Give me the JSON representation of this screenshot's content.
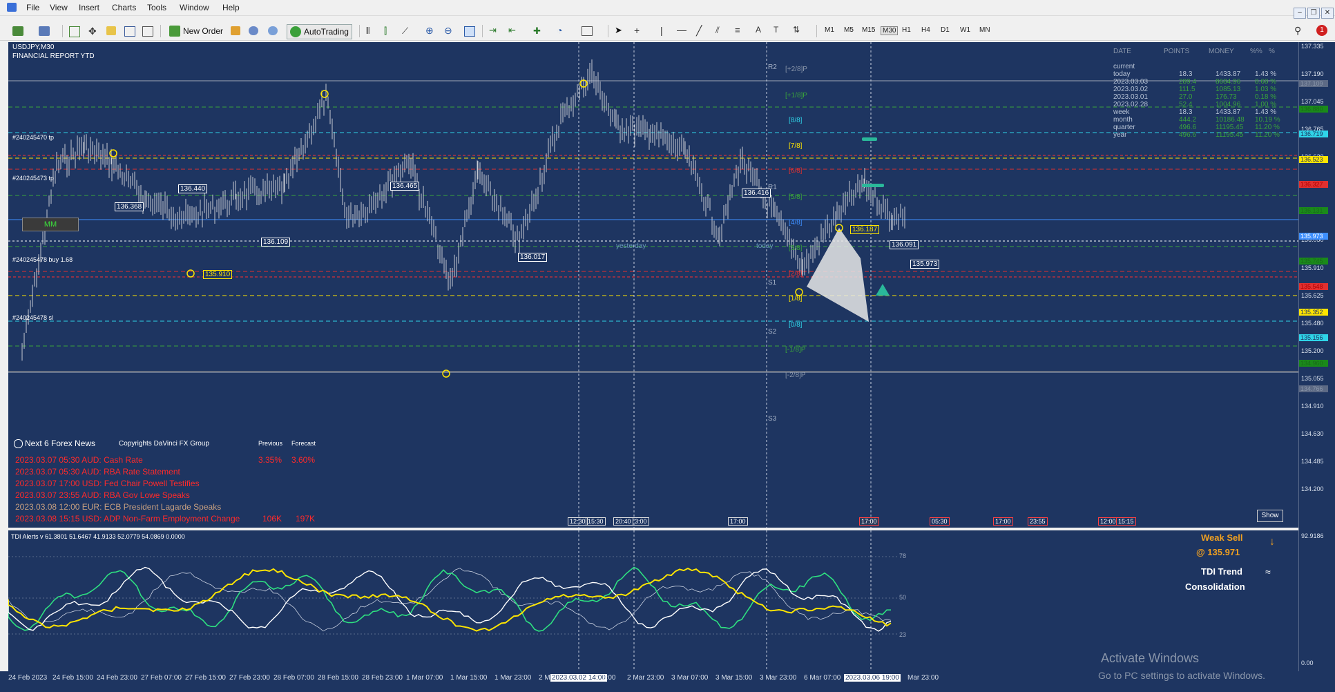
{
  "menu": [
    "File",
    "View",
    "Insert",
    "Charts",
    "Tools",
    "Window",
    "Help"
  ],
  "toolbar": {
    "new_order": "New Order",
    "autotrading": "AutoTrading",
    "timeframes": [
      "M1",
      "M5",
      "M15",
      "M30",
      "H1",
      "H4",
      "D1",
      "W1",
      "MN"
    ]
  },
  "chart": {
    "symbol_title": "USDJPY,M30",
    "subtitle": "FINANCIAL REPORT YTD",
    "order_labels": [
      "#240245470 tp",
      "#240245473 tp",
      "#240245478 buy 1.68",
      "#240245478 sl"
    ],
    "mm_button": "MM",
    "price_tags": [
      "136.440",
      "136.368",
      "136.465",
      "136.109",
      "135.910",
      "136.017",
      "136.416",
      "136.187",
      "136.091",
      "135.973"
    ],
    "murrey": [
      {
        "text": "[+2/8]P",
        "color": "#8a96aa"
      },
      {
        "text": "[+1/8]P",
        "color": "#3aa53a"
      },
      {
        "text": "[8/8]",
        "color": "#2fd4e8"
      },
      {
        "text": "[7/8]",
        "color": "#ffe500"
      },
      {
        "text": "[6/8]",
        "color": "#e03030"
      },
      {
        "text": "[5/8]",
        "color": "#3aa53a"
      },
      {
        "text": "[4/8]",
        "color": "#3e8fff"
      },
      {
        "text": "[3/8]",
        "color": "#3aa53a"
      },
      {
        "text": "[2/8]",
        "color": "#e03030"
      },
      {
        "text": "[1/8]",
        "color": "#ffe500"
      },
      {
        "text": "[0/8]",
        "color": "#2fd4e8"
      },
      {
        "text": "[-1/8]P",
        "color": "#3aa53a"
      },
      {
        "text": "[-2/8]P",
        "color": "#8a96aa"
      }
    ],
    "pivot_labels": [
      "R2",
      "R1",
      "S1",
      "S2",
      "S3"
    ],
    "session_labels": [
      "yesterday",
      "today"
    ],
    "show_button": "Show",
    "event_times": [
      "12:30",
      "15:30",
      "20:40",
      "3:00",
      "17:00",
      "17:00",
      "05:30",
      "17:00",
      "23:55",
      "12:00",
      "15:15"
    ]
  },
  "financial_report": {
    "headers": [
      "DATE",
      "POINTS",
      "MONEY",
      "%%",
      "%"
    ],
    "rows": [
      {
        "date": "current",
        "points": "",
        "money": "",
        "pct": ""
      },
      {
        "date": "today",
        "points": "18.3",
        "money": "1433.87",
        "pct": "1.43 %"
      },
      {
        "date": "2023.03.03",
        "points": "289.4",
        "money": "8684.96",
        "pct": "8.68 %"
      },
      {
        "date": "2023.03.02",
        "points": "111.5",
        "money": "1085.13",
        "pct": "1.03 %"
      },
      {
        "date": "2023.03.01",
        "points": "27.0",
        "money": "176.73",
        "pct": "0.18 %"
      },
      {
        "date": "2023.02.28",
        "points": "52.4",
        "money": "1004.96",
        "pct": "1.00 %"
      },
      {
        "date": "week",
        "points": "18.3",
        "money": "1433.87",
        "pct": "1.43 %"
      },
      {
        "date": "month",
        "points": "444.2",
        "money": "10186.48",
        "pct": "10.19 %"
      },
      {
        "date": "quarter",
        "points": "496.6",
        "money": "11195.45",
        "pct": "11.20 %"
      },
      {
        "date": "year",
        "points": "496.6",
        "money": "11195.45",
        "pct": "11.20 %"
      }
    ]
  },
  "news": {
    "header": "Next 6 Forex News",
    "copyright": "Copyrights DaVinci FX Group",
    "col_previous": "Previous",
    "col_forecast": "Forecast",
    "items": [
      {
        "text": "2023.03.07 05:30   AUD: Cash Rate",
        "previous": "3.35%",
        "forecast": "3.60%"
      },
      {
        "text": "2023.03.07 05:30   AUD: RBA Rate Statement",
        "previous": "",
        "forecast": ""
      },
      {
        "text": "2023.03.07 17:00   USD: Fed Chair Powell Testifies",
        "previous": "",
        "forecast": ""
      },
      {
        "text": "2023.03.07 23:55   AUD: RBA Gov Lowe Speaks",
        "previous": "",
        "forecast": ""
      },
      {
        "text": "2023.03.08 12:00   EUR: ECB President Lagarde Speaks",
        "previous": "",
        "forecast": ""
      },
      {
        "text": "2023.03.08 15:15   USD: ADP Non-Farm Employment Change",
        "previous": "106K",
        "forecast": "197K"
      }
    ]
  },
  "indicator": {
    "title": "TDI Alerts v 61.3801 51.6467 41.9133 52.0779 54.0869 0.0000",
    "levels": [
      "78",
      "50",
      "23"
    ],
    "signal": "Weak Sell",
    "signal_price": "@ 135.971",
    "trend_label": "TDI Trend",
    "trend_value": "Consolidation",
    "axis_top": "92.9186",
    "axis_bottom": "0.00"
  },
  "price_axis": {
    "ticks": [
      "137.335",
      "137.190",
      "137.045",
      "136.765",
      "136.620",
      "136.475",
      "136.195",
      "136.050",
      "135.910",
      "135.625",
      "135.480",
      "135.200",
      "135.055",
      "134.910",
      "134.630",
      "134.485",
      "134.200"
    ],
    "boxes": [
      {
        "text": "137.109",
        "color": "#8a96aa",
        "bg": "#5d6a85"
      },
      {
        "text": "136.880",
        "color": "#1a6a1a",
        "bg": "#1a8a1a"
      },
      {
        "text": "136.719",
        "color": "#1e3561",
        "bg": "#2fd4e8"
      },
      {
        "text": "136.523",
        "color": "#1e3561",
        "bg": "#ffe500"
      },
      {
        "text": "136.327",
        "color": "#b00000",
        "bg": "#e03030"
      },
      {
        "text": "136.131",
        "color": "#1a6a1a",
        "bg": "#1a8a1a"
      },
      {
        "text": "135.973",
        "color": "#ffffff",
        "bg": "#3e8fff"
      },
      {
        "text": "135.745",
        "color": "#1a6a1a",
        "bg": "#1a8a1a"
      },
      {
        "text": "135.548",
        "color": "#b00000",
        "bg": "#e03030"
      },
      {
        "text": "135.352",
        "color": "#1e3561",
        "bg": "#ffe500"
      },
      {
        "text": "135.156",
        "color": "#1e3561",
        "bg": "#2fd4e8"
      },
      {
        "text": "134.960",
        "color": "#1a6a1a",
        "bg": "#1a8a1a"
      },
      {
        "text": "134.766",
        "color": "#8a96aa",
        "bg": "#5d6a85"
      }
    ]
  },
  "time_axis": {
    "ticks": [
      "24 Feb 2023",
      "24 Feb 15:00",
      "24 Feb 23:00",
      "27 Feb 07:00",
      "27 Feb 15:00",
      "27 Feb 23:00",
      "28 Feb 07:00",
      "28 Feb 15:00",
      "28 Feb 23:00",
      "1 Mar 07:00",
      "1 Mar 15:00",
      "1 Mar 23:00",
      "2 M",
      "2 Mar 23:00",
      "3 Mar 07:00",
      "3 Mar 15:00",
      "3 Mar 23:00",
      "6 Mar 07:00",
      "Mar 23:00"
    ],
    "highlight_1": "2023.03.02 14:00",
    "highlight_2": "2023.03.06 19:00",
    "after_highlight": "5:00"
  },
  "watermark": {
    "title": "Activate Windows",
    "subtitle": "Go to PC settings to activate Windows."
  }
}
